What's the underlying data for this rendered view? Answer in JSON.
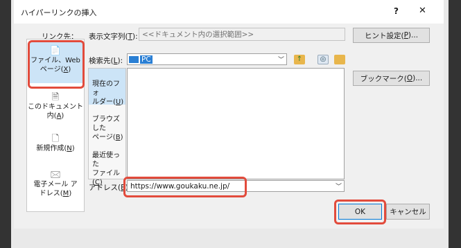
{
  "dialog": {
    "title": "ハイパーリンクの挿入",
    "help": "?",
    "close": "✕"
  },
  "link_target": {
    "label": "リンク先："
  },
  "display_text": {
    "label_prefix": "表示文字列(",
    "accel": "T",
    "label_suffix": "):",
    "value": "<<ドキュメント内の選択範囲>>"
  },
  "screentip_button": {
    "prefix": "ヒント設定(",
    "accel": "P",
    "suffix": ")..."
  },
  "left_nav": {
    "file_web": {
      "line1": "ファイル、Web",
      "line2_prefix": "ページ(",
      "accel": "X",
      "line2_suffix": ")"
    },
    "this_doc": {
      "line1": "このドキュメント",
      "line2_prefix": "内(",
      "accel": "A",
      "line2_suffix": ")"
    },
    "new_doc": {
      "prefix": "新規作成(",
      "accel": "N",
      "suffix": ")"
    },
    "email": {
      "line1": "電子メール ア",
      "line2_prefix": "ドレス(",
      "accel": "M",
      "line2_suffix": ")"
    }
  },
  "look_in": {
    "label_prefix": "検索先(",
    "accel": "L",
    "label_suffix": "):",
    "value": "PC"
  },
  "bookmark_button": {
    "prefix": "ブックマーク(",
    "accel": "O",
    "suffix": ")..."
  },
  "mid_nav": {
    "current_folder": {
      "line1": "現在のフォ",
      "line2_prefix": "ルダー(",
      "accel": "U",
      "line2_suffix": ")"
    },
    "browsed": {
      "line1": "ブラウズした",
      "line2_prefix": "ページ(",
      "accel": "B",
      "line2_suffix": ")"
    },
    "recent": {
      "line1": "最近使った",
      "line2_prefix": "ファイル(",
      "accel": "C",
      "line2_suffix": ")"
    }
  },
  "address": {
    "label_prefix": "アドレス(",
    "accel": "E",
    "label_suffix": "):",
    "value": "https://www.goukaku.ne.jp/"
  },
  "ok_button": {
    "label": "OK"
  },
  "cancel_button": {
    "label": "キャンセル"
  },
  "colors": {
    "highlight": "#e24b3c",
    "selected_nav": "#cce4f7",
    "pc_icon": "#2a7fd4",
    "folder_icon": "#e8b64c"
  }
}
